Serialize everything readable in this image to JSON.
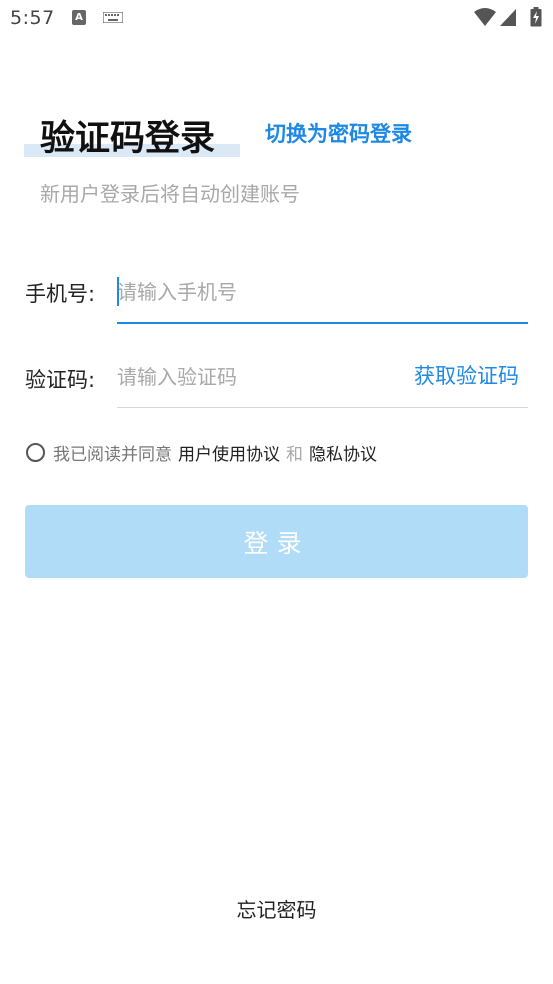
{
  "status_bar": {
    "time": "5:57",
    "a_icon_glyph": "A",
    "icons": [
      "notification-a-icon",
      "keyboard-icon",
      "wifi-icon",
      "signal-icon",
      "battery-icon"
    ]
  },
  "header": {
    "title": "验证码登录",
    "switch_label": "切换为密码登录",
    "subtitle": "新用户登录后将自动创建账号"
  },
  "form": {
    "phone_label": "手机号:",
    "phone_placeholder": "请输入手机号",
    "phone_value": "",
    "code_label": "验证码:",
    "code_placeholder": "请输入验证码",
    "code_value": "",
    "get_code_label": "获取验证码"
  },
  "agreement": {
    "prefix": "我已阅读并同意",
    "user_agreement": "用户使用协议",
    "and": "和",
    "privacy_agreement": "隐私协议",
    "checked": false
  },
  "login_button": "登录",
  "forgot_password": "忘记密码",
  "colors": {
    "accent": "#1e88e5",
    "button_disabled": "#b0dcf8",
    "title_highlight": "#dbe9f6",
    "placeholder": "#a8a8a8"
  }
}
